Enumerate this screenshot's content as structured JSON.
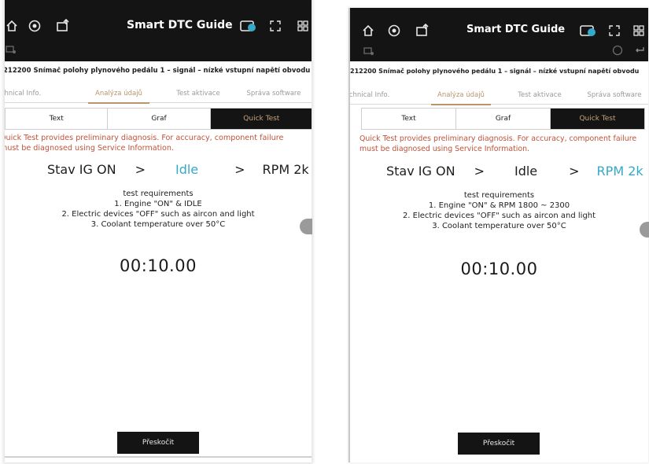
{
  "screens": [
    {
      "header": {
        "title": "Smart DTC Guide",
        "left_icons": [
          "home-icon",
          "gear-badge-icon",
          "vehicle-upload-icon"
        ],
        "right_icons": [
          "toggle-camera-icon",
          "fullscreen-icon",
          "grid-icon"
        ],
        "sub_icons": [
          "car-connect-icon"
        ]
      },
      "dtc_title": "212200 Snímač polohy plynového pedálu 1 – signál – nízké vstupní napětí obvodu",
      "tabs": [
        {
          "label": "Technical Info.",
          "active": false
        },
        {
          "label": "Analýza údajů",
          "active": true
        },
        {
          "label": "Test aktivace",
          "active": false
        },
        {
          "label": "Správa software",
          "active": false
        }
      ],
      "segments": [
        {
          "label": "Text",
          "active": false
        },
        {
          "label": "Graf",
          "active": false
        },
        {
          "label": "Quick Test",
          "active": true
        }
      ],
      "notice": {
        "line1": "Quick Test provides preliminary diagnosis. For accuracy, component failure",
        "line2": "must be diagnosed using Service Information."
      },
      "steps": {
        "step1": "Stav IG ON",
        "sep1": ">",
        "step2": "Idle",
        "sep2": ">",
        "step3": "RPM 2k",
        "active_step": 2
      },
      "requirements": {
        "heading": "test requirements",
        "items": [
          "1. Engine \"ON\" & IDLE",
          "2. Electric devices \"OFF\" such as aircon and light",
          "3. Coolant temperature over 50°C"
        ]
      },
      "timer": "00:10.00",
      "skip_label": "Přeskočit"
    },
    {
      "header": {
        "title": "Smart DTC Guide",
        "left_icons": [
          "home-icon",
          "gear-badge-icon",
          "vehicle-upload-icon"
        ],
        "right_icons": [
          "toggle-camera-icon",
          "fullscreen-icon",
          "grid-icon"
        ],
        "sub_icons": [
          "car-connect-icon",
          "help-icon",
          "swap-icon"
        ]
      },
      "dtc_title": "212200 Snímač polohy plynového pedálu 1 – signál – nízké vstupní napětí obvodu",
      "tabs": [
        {
          "label": "Technical Info.",
          "active": false
        },
        {
          "label": "Analýza údajů",
          "active": true
        },
        {
          "label": "Test aktivace",
          "active": false
        },
        {
          "label": "Správa software",
          "active": false
        }
      ],
      "segments": [
        {
          "label": "Text",
          "active": false
        },
        {
          "label": "Graf",
          "active": false
        },
        {
          "label": "Quick Test",
          "active": true
        }
      ],
      "notice": {
        "line1": "Quick Test provides preliminary diagnosis. For accuracy, component failure",
        "line2": "must be diagnosed using Service Information."
      },
      "steps": {
        "step1": "Stav IG ON",
        "sep1": ">",
        "step2": "Idle",
        "sep2": ">",
        "step3": "RPM 2k",
        "active_step": 3
      },
      "requirements": {
        "heading": "test requirements",
        "items": [
          "1. Engine \"ON\" & RPM 1800 ~ 2300",
          "2. Electric devices \"OFF\" such as aircon and light",
          "3. Coolant temperature over 50°C"
        ]
      },
      "timer": "00:10.00",
      "skip_label": "Přeskočit"
    }
  ],
  "colors": {
    "header_bg": "#141414",
    "accent_gold": "#b9956e",
    "notice_red": "#c0533a",
    "active_step_blue": "#35a9c9"
  }
}
